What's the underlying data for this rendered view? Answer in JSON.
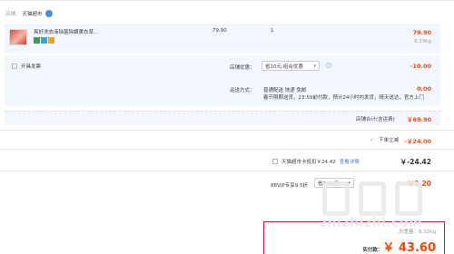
{
  "shop": {
    "label": "店铺：",
    "name": "天猫超市"
  },
  "item": {
    "title": "爽好洗衣液除菌除螨薰衣草...",
    "unit_price": "79.90",
    "quantity": "1",
    "subtotal": "79.90",
    "weight": "6.33kg"
  },
  "invoice": {
    "label": "开具发票"
  },
  "shop_discount": {
    "label": "店铺优惠：",
    "value": "省10元:组合优惠",
    "amount": "-10.00"
  },
  "shipping": {
    "label": "运送方式：",
    "method": "普通配送 快递 免邮",
    "note": "春节限期送货，23:59前付款，预计24小时内发货，晴天送达，官方上门",
    "amount": "0.00"
  },
  "shop_total": {
    "label": "店铺合计(含运费)",
    "amount": "￥69.90"
  },
  "instant": {
    "label": "下单立减",
    "amount": "-￥24.00"
  },
  "card": {
    "label": "天猫超市卡抵扣￥24.42",
    "link": "查看详情",
    "amount": "￥-24.42"
  },
  "vip": {
    "label": "88VIP专享9.5折",
    "select": "省7.20元",
    "amount": "-￥2.20"
  },
  "summary": {
    "weight_label": "总重量：",
    "weight": "6.33kg",
    "paid_label": "实付款：",
    "paid": "￥ 43.60"
  },
  "watermark": {
    "text": "zhizhizhi.com"
  },
  "colors": {
    "accent": "#ff4400",
    "row_bg": "#f2f7ff",
    "summary_border": "#ff0036"
  }
}
